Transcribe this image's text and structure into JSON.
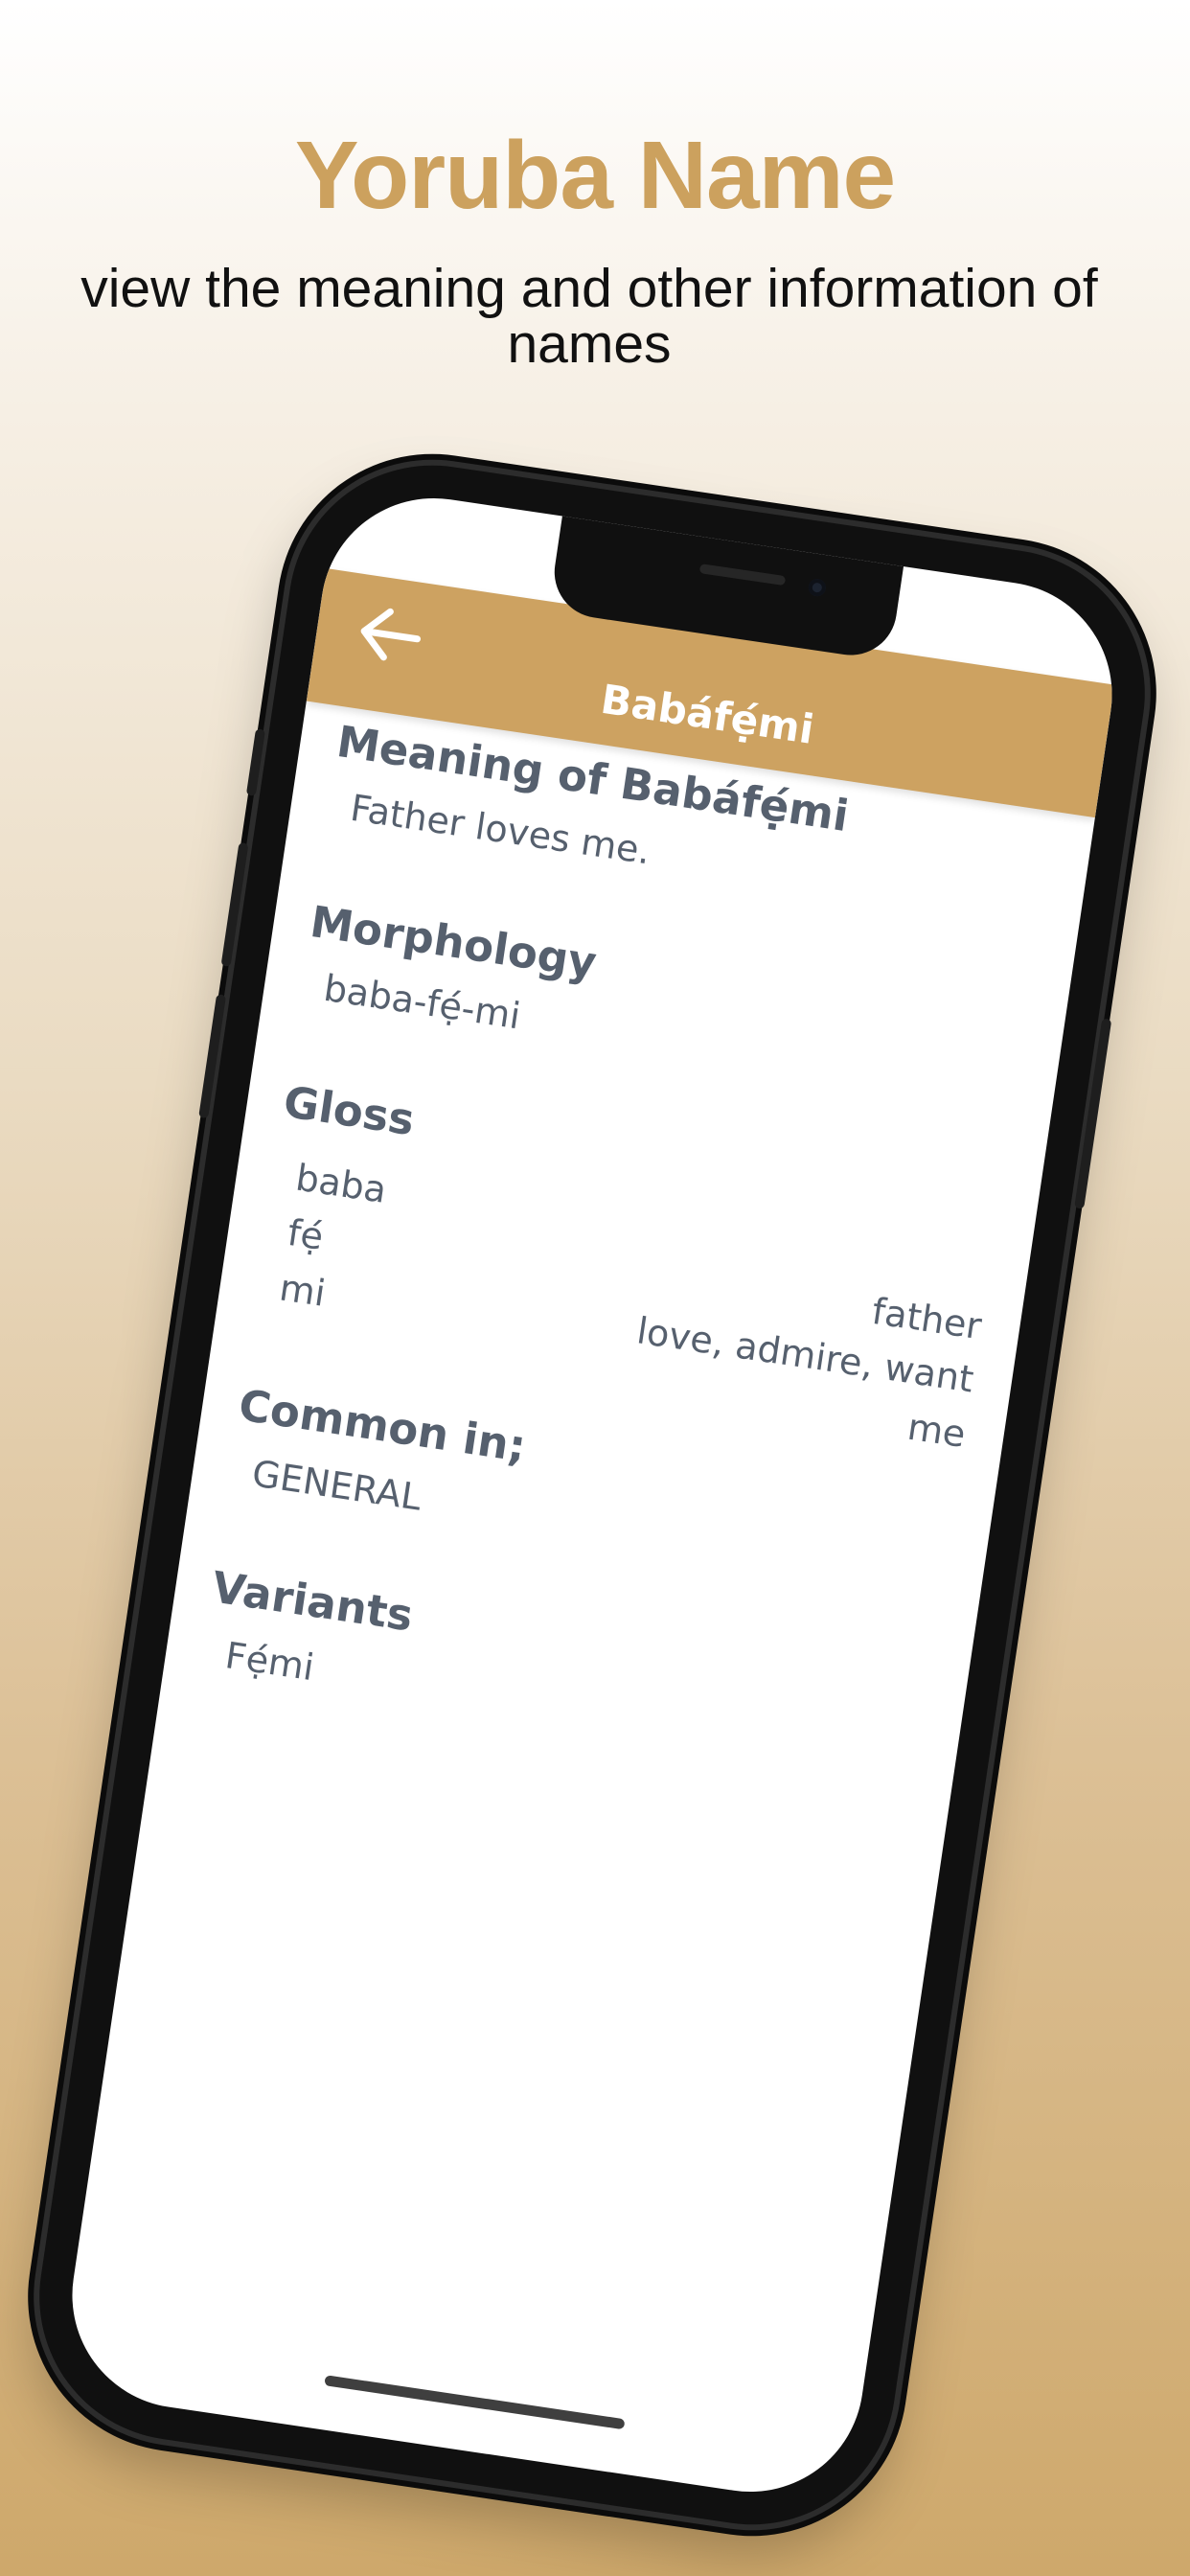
{
  "promo": {
    "title": "Yoruba Name",
    "subtitle": "view the meaning and other information of names"
  },
  "header": {
    "back_icon": "arrow-left-icon",
    "title": "Babáfẹ́mi"
  },
  "details": {
    "meaning_heading": "Meaning of Babáfẹ́mi",
    "meaning_value": "Father loves me.",
    "morphology_heading": "Morphology",
    "morphology_value": "baba-fẹ́-mi",
    "gloss_heading": "Gloss",
    "gloss": [
      {
        "part": "baba",
        "meaning": "father"
      },
      {
        "part": "fẹ́",
        "meaning": "love, admire, want"
      },
      {
        "part": "mi",
        "meaning": "me"
      }
    ],
    "common_heading": "Common in;",
    "common_value": "GENERAL",
    "variants_heading": "Variants",
    "variants_value": "Fẹ́mi"
  },
  "colors": {
    "accent": "#cda261",
    "title_gold": "#cca15e",
    "text_slate": "#56606e"
  }
}
